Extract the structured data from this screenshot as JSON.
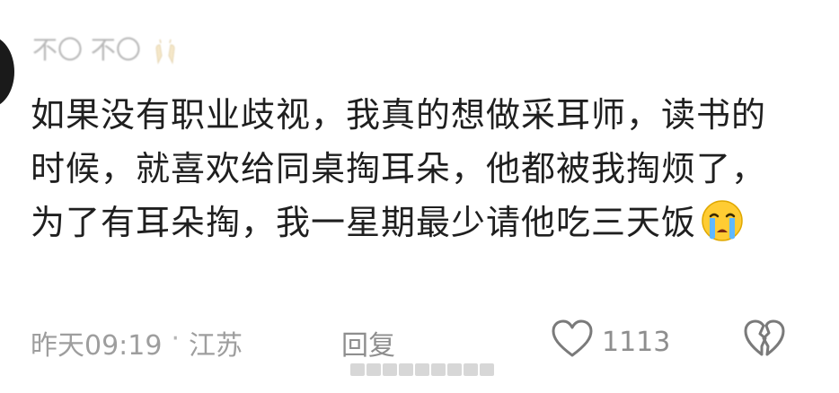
{
  "user": {
    "name": "不〇 不〇",
    "emoji": "clapping-hands-icon"
  },
  "comment": {
    "text": "如果没有职业歧视，我真的想做采耳师，读书的时候，就喜欢给同桌掏耳朵，他都被我掏烦了，为了有耳朵掏，我一星期最少请他吃三天饭",
    "emoji": "loudly-crying-face-icon"
  },
  "meta": {
    "time": "昨天09:19",
    "separator": "·",
    "location": "江苏",
    "reply_label": "回复"
  },
  "stats": {
    "likes": "1113"
  },
  "icons": {
    "like": "heart-outline-icon",
    "dislike": "broken-heart-icon"
  },
  "colors": {
    "text": "#1f1f1f",
    "meta": "#9e9e9e",
    "username": "#b9b9b9"
  }
}
